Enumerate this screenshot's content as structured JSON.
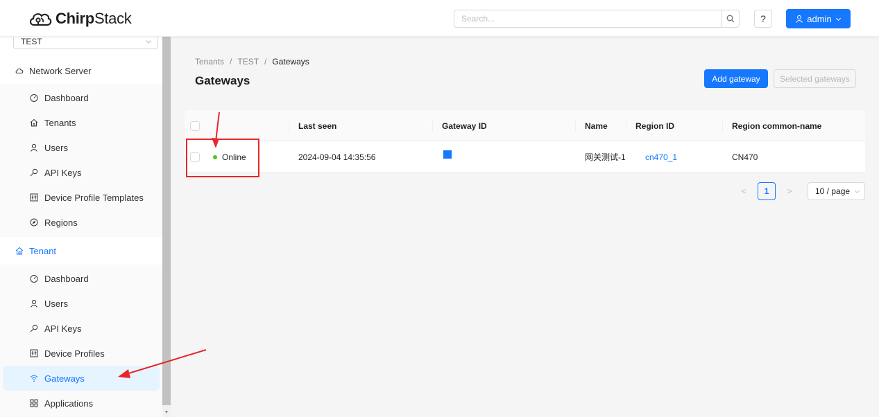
{
  "header": {
    "brand_bold": "Chirp",
    "brand_rest": "Stack",
    "search_placeholder": "Search...",
    "help_label": "?",
    "user_label": "admin"
  },
  "sidebar": {
    "tenant_selected": "TEST",
    "network_server": {
      "label": "Network Server",
      "items": [
        {
          "label": "Dashboard",
          "icon": "dashboard-icon"
        },
        {
          "label": "Tenants",
          "icon": "home-icon"
        },
        {
          "label": "Users",
          "icon": "user-icon"
        },
        {
          "label": "API Keys",
          "icon": "key-icon"
        },
        {
          "label": "Device Profile Templates",
          "icon": "template-icon"
        },
        {
          "label": "Regions",
          "icon": "compass-icon"
        }
      ]
    },
    "tenant": {
      "label": "Tenant",
      "items": [
        {
          "label": "Dashboard",
          "icon": "dashboard-icon"
        },
        {
          "label": "Users",
          "icon": "user-icon"
        },
        {
          "label": "API Keys",
          "icon": "key-icon"
        },
        {
          "label": "Device Profiles",
          "icon": "template-icon"
        },
        {
          "label": "Gateways",
          "icon": "wifi-icon",
          "active": true
        },
        {
          "label": "Applications",
          "icon": "apps-icon"
        }
      ]
    }
  },
  "main": {
    "breadcrumb": [
      "Tenants",
      "TEST",
      "Gateways"
    ],
    "breadcrumb_sep": "/",
    "title": "Gateways",
    "add_button": "Add gateway",
    "selected_button": "Selected gateways",
    "table": {
      "columns": [
        "",
        "Last seen",
        "Gateway ID",
        "Name",
        "Region ID",
        "Region common-name"
      ],
      "rows": [
        {
          "status": "Online",
          "last_seen": "2024-09-04 14:35:56",
          "gateway_id": "",
          "name": "网关测试-1",
          "region_id": "cn470_1",
          "region_common_name": "CN470"
        }
      ]
    },
    "pagination": {
      "prev": "<",
      "page": "1",
      "next": ">",
      "page_size": "10 / page"
    }
  },
  "colors": {
    "primary": "#1677ff",
    "online": "#52c41a",
    "annotation": "#e8262a"
  }
}
